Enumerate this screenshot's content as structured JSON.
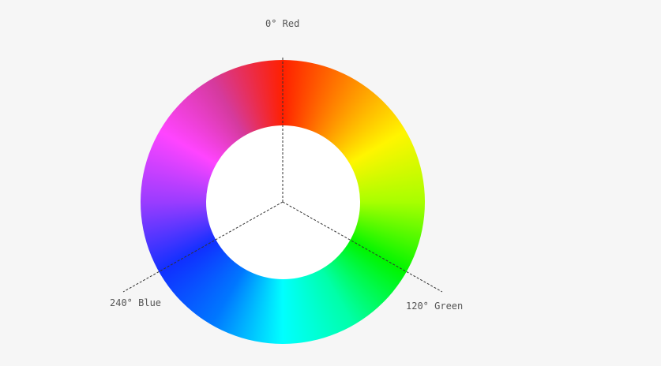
{
  "wheel": {
    "hues": [
      {
        "label": "0° Red",
        "color": "#ff2000"
      },
      {
        "label": "120° Green",
        "color": "#00f500"
      },
      {
        "label": "240° Blue",
        "color": "#1030ff"
      }
    ]
  }
}
